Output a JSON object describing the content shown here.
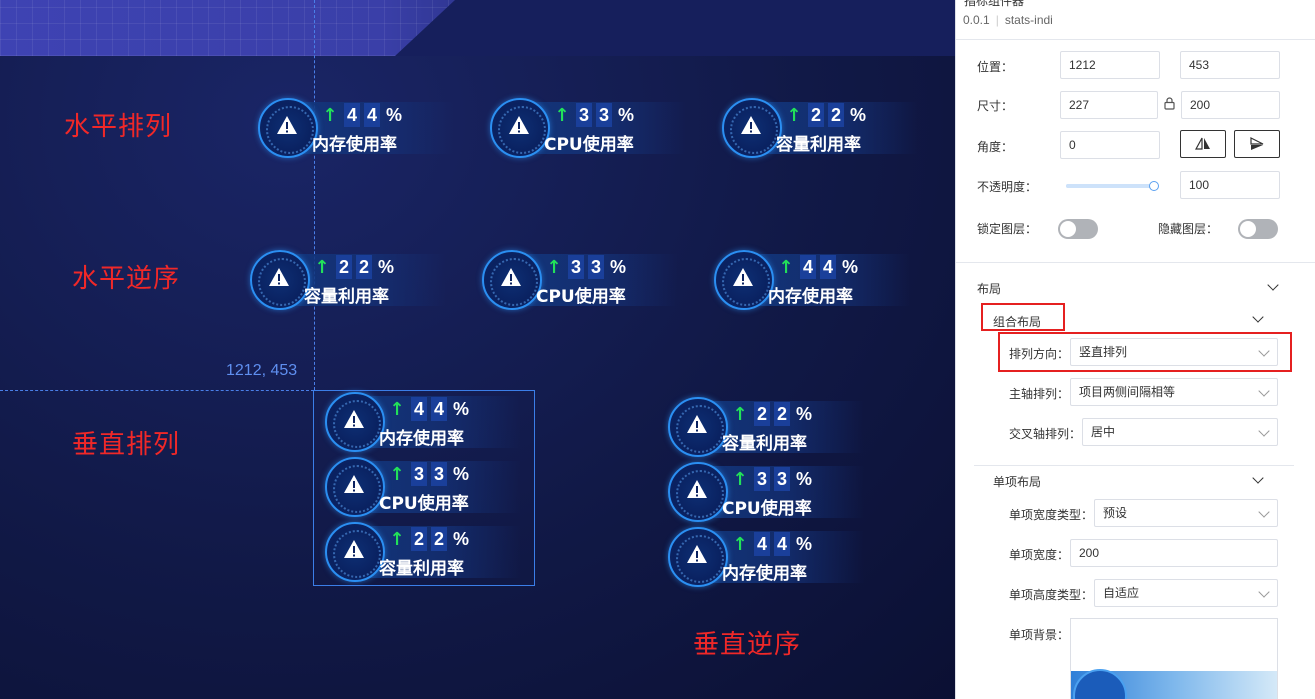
{
  "canvas": {
    "headings": {
      "horizontal": "水平排列",
      "horizontal_reverse": "水平逆序",
      "vertical": "垂直排列",
      "vertical_reverse": "垂直逆序"
    },
    "coord_readout": "1212, 453",
    "groups": {
      "horizontal": [
        {
          "d1": "4",
          "d2": "4",
          "pct": "%",
          "label": "内存使用率"
        },
        {
          "d1": "3",
          "d2": "3",
          "pct": "%",
          "label": "CPU使用率"
        },
        {
          "d1": "2",
          "d2": "2",
          "pct": "%",
          "label": "容量利用率"
        }
      ],
      "horizontal_reverse": [
        {
          "d1": "2",
          "d2": "2",
          "pct": "%",
          "label": "容量利用率"
        },
        {
          "d1": "3",
          "d2": "3",
          "pct": "%",
          "label": "CPU使用率"
        },
        {
          "d1": "4",
          "d2": "4",
          "pct": "%",
          "label": "内存使用率"
        }
      ],
      "vertical": [
        {
          "d1": "4",
          "d2": "4",
          "pct": "%",
          "label": "内存使用率"
        },
        {
          "d1": "3",
          "d2": "3",
          "pct": "%",
          "label": "CPU使用率"
        },
        {
          "d1": "2",
          "d2": "2",
          "pct": "%",
          "label": "容量利用率"
        }
      ],
      "vertical_reverse": [
        {
          "d1": "2",
          "d2": "2",
          "pct": "%",
          "label": "容量利用率"
        },
        {
          "d1": "3",
          "d2": "3",
          "pct": "%",
          "label": "CPU使用率"
        },
        {
          "d1": "4",
          "d2": "4",
          "pct": "%",
          "label": "内存使用率"
        }
      ]
    },
    "arrow_icon": "arrow-up-icon",
    "card_icon": "warning-icon",
    "colors": {
      "heading": "#f02828",
      "arrow": "#22e05a",
      "accent": "#2b8ff2",
      "guide": "#4a7fe8"
    }
  },
  "panel": {
    "title": "指标组件器",
    "version": "0.0.1",
    "component_id": "stats-indi",
    "position": {
      "label": "位置：",
      "x": "1212",
      "y": "453"
    },
    "size": {
      "label": "尺寸：",
      "w": "227",
      "h": "200"
    },
    "angle": {
      "label": "角度：",
      "value": "0"
    },
    "opacity": {
      "label": "不透明度：",
      "value": "100",
      "level": 1.0
    },
    "lock_layer": {
      "label": "锁定图层："
    },
    "hide_layer": {
      "label": "隐藏图层："
    },
    "layout": {
      "section": "布局",
      "group_layout": "组合布局",
      "direction": {
        "label": "排列方向：",
        "value": "竖直排列"
      },
      "main_axis": {
        "label": "主轴排列：",
        "value": "项目两侧间隔相等"
      },
      "cross_axis": {
        "label": "交叉轴排列：",
        "value": "居中"
      }
    },
    "item_layout": {
      "section": "单项布局",
      "width_type": {
        "label": "单项宽度类型：",
        "value": "预设"
      },
      "width": {
        "label": "单项宽度：",
        "value": "200"
      },
      "height_type": {
        "label": "单项高度类型：",
        "value": "自适应"
      },
      "background": {
        "label": "单项背景："
      }
    }
  }
}
